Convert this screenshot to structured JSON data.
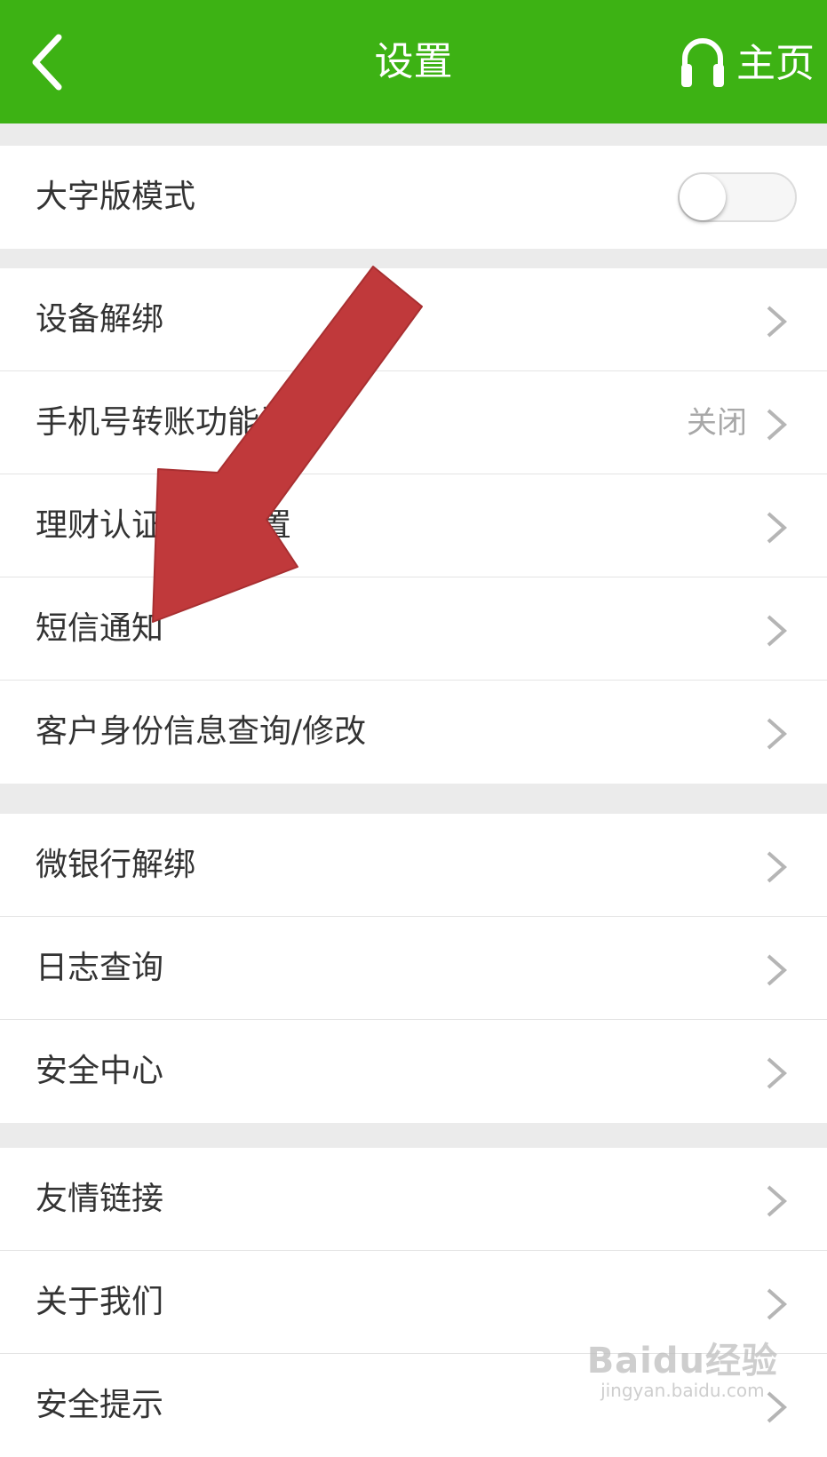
{
  "header": {
    "title": "设置",
    "home_label": "主页",
    "bg_color": "#3db214"
  },
  "groups": [
    {
      "rows": [
        {
          "label": "大字版模式",
          "control": "toggle",
          "toggle_on": false
        }
      ]
    },
    {
      "rows": [
        {
          "label": "设备解绑"
        },
        {
          "label": "手机号转账功能设置",
          "value": "关闭"
        },
        {
          "label": "理财认证方式设置"
        },
        {
          "label": "短信通知"
        },
        {
          "label": "客户身份信息查询/修改"
        }
      ]
    },
    {
      "rows": [
        {
          "label": "微银行解绑"
        },
        {
          "label": "日志查询"
        },
        {
          "label": "安全中心"
        }
      ]
    },
    {
      "rows": [
        {
          "label": "友情链接"
        },
        {
          "label": "关于我们"
        },
        {
          "label": "安全提示"
        }
      ]
    }
  ],
  "annotation_arrow": {
    "color": "#c0393b",
    "points_to": "短信通知"
  },
  "watermark": {
    "brand": "Baidu经验",
    "url": "jingyan.baidu.com"
  }
}
